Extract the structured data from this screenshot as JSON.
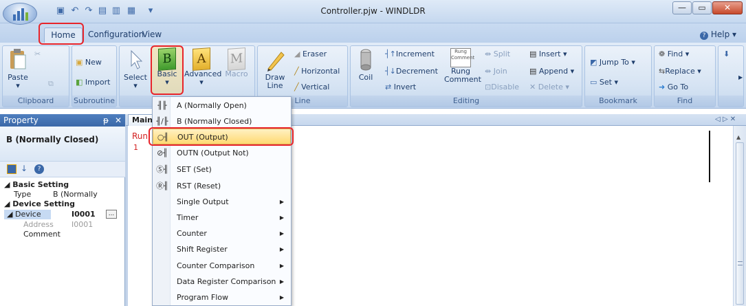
{
  "window": {
    "title": "Controller.pjw - WINDLDR",
    "min": "—",
    "max": "▭",
    "close": "✕"
  },
  "app_button": {
    "icon": "windldr-logo-icon"
  },
  "quick_access": [
    {
      "icon": "save-icon",
      "glyph": "▣"
    },
    {
      "icon": "undo-icon",
      "glyph": "↶"
    },
    {
      "icon": "redo-icon",
      "glyph": "↷"
    },
    {
      "icon": "print-icon",
      "glyph": "▤"
    },
    {
      "icon": "monitor-icon",
      "glyph": "▥"
    },
    {
      "icon": "online-icon",
      "glyph": "▦"
    },
    {
      "icon": "customize-icon",
      "glyph": "▾"
    }
  ],
  "tabs": [
    {
      "label": "Home"
    },
    {
      "label": "Configuration"
    },
    {
      "label": "View"
    }
  ],
  "help": "Help",
  "ribbon": {
    "clipboard": {
      "group": "Clipboard",
      "paste": "Paste"
    },
    "subroutine": {
      "group": "Subroutine",
      "new": "New",
      "import": "Import"
    },
    "select": "Select",
    "basic": "Basic",
    "basic_letter": "B",
    "advanced": "Advanced",
    "advanced_letter": "A",
    "macro": "Macro",
    "macro_letter": "M",
    "line": {
      "group": "Line",
      "draw": "Draw",
      "draw2": "Line",
      "eraser": "Eraser",
      "horizontal": "Horizontal",
      "vertical": "Vertical"
    },
    "editing": {
      "group": "Editing",
      "coil": "Coil",
      "increment": "Increment",
      "decrement": "Decrement",
      "invert": "Invert",
      "rung": "Rung",
      "rung2": "Comment",
      "split": "Split",
      "join": "Join",
      "disable": "Disable",
      "insert": "Insert",
      "append": "Append",
      "delete": "Delete"
    },
    "bookmark": {
      "group": "Bookmark",
      "jump": "Jump To",
      "set": "Set"
    },
    "find": {
      "group": "Find",
      "find": "Find",
      "replace": "Replace",
      "goto": "Go To"
    }
  },
  "property": {
    "header": "Property",
    "pin": "ᵽ",
    "close": "✕",
    "title": "B (Normally Closed)",
    "basic_setting": "Basic Setting",
    "type_label": "Type",
    "type_value": "B (Normally",
    "device_setting": "Device Setting",
    "device_label": "Device",
    "device_value": "I0001",
    "device_btn": "...",
    "address_label": "Address",
    "address_value": "I0001",
    "comment_label": "Comment"
  },
  "editor": {
    "tab": "Main",
    "run": "Run",
    "line": "1",
    "nav": "◁ ▷ ✕"
  },
  "menu": [
    {
      "icon": "╢╟",
      "label": "A (Normally Open)",
      "sub": false
    },
    {
      "icon": "╢/╟",
      "label": "B (Normally Closed)",
      "sub": false
    },
    {
      "icon": "○╢",
      "label": "OUT (Output)",
      "sub": false,
      "highlighted": true
    },
    {
      "icon": "⊘╢",
      "label": "OUTN (Output Not)",
      "sub": false
    },
    {
      "icon": "Ⓢ╢",
      "label": "SET (Set)",
      "sub": false
    },
    {
      "icon": "Ⓡ╢",
      "label": "RST (Reset)",
      "sub": false
    },
    {
      "icon": "",
      "label": "Single Output",
      "sub": true
    },
    {
      "icon": "",
      "label": "Timer",
      "sub": true
    },
    {
      "icon": "",
      "label": "Counter",
      "sub": true
    },
    {
      "icon": "",
      "label": "Shift Register",
      "sub": true
    },
    {
      "icon": "",
      "label": "Counter Comparison",
      "sub": true
    },
    {
      "icon": "",
      "label": "Data Register Comparison",
      "sub": true
    },
    {
      "icon": "",
      "label": "Program Flow",
      "sub": true
    }
  ]
}
